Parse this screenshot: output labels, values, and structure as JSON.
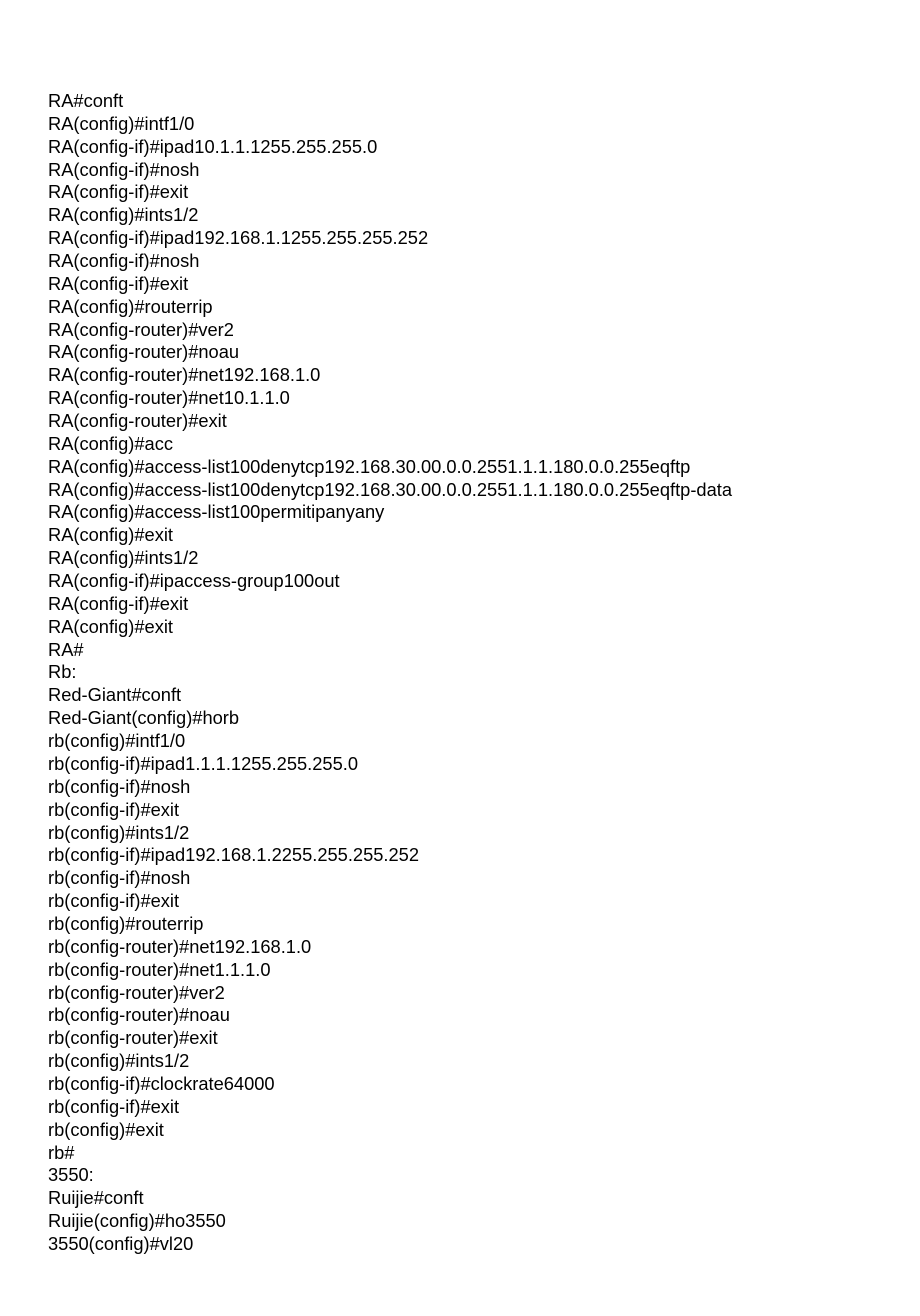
{
  "lines": [
    "RA#conft",
    "RA(config)#intf1/0",
    "RA(config-if)#ipad10.1.1.1255.255.255.0",
    "RA(config-if)#nosh",
    "RA(config-if)#exit",
    "RA(config)#ints1/2",
    "RA(config-if)#ipad192.168.1.1255.255.255.252",
    "RA(config-if)#nosh",
    "RA(config-if)#exit",
    "RA(config)#routerrip",
    "RA(config-router)#ver2",
    "RA(config-router)#noau",
    "RA(config-router)#net192.168.1.0",
    "RA(config-router)#net10.1.1.0",
    "RA(config-router)#exit",
    "RA(config)#acc",
    "RA(config)#access-list100denytcp192.168.30.00.0.0.2551.1.1.180.0.0.255eqftp",
    "RA(config)#access-list100denytcp192.168.30.00.0.0.2551.1.1.180.0.0.255eqftp-data",
    "RA(config)#access-list100permitipanyany",
    "RA(config)#exit",
    "RA(config)#ints1/2",
    "RA(config-if)#ipaccess-group100out",
    "RA(config-if)#exit",
    "RA(config)#exit",
    "RA#",
    "Rb:",
    "Red-Giant#conft",
    "Red-Giant(config)#horb",
    "rb(config)#intf1/0",
    "rb(config-if)#ipad1.1.1.1255.255.255.0",
    "rb(config-if)#nosh",
    "rb(config-if)#exit",
    "rb(config)#ints1/2",
    "rb(config-if)#ipad192.168.1.2255.255.255.252",
    "rb(config-if)#nosh",
    "rb(config-if)#exit",
    "rb(config)#routerrip",
    "rb(config-router)#net192.168.1.0",
    "rb(config-router)#net1.1.1.0",
    "rb(config-router)#ver2",
    "rb(config-router)#noau",
    "rb(config-router)#exit",
    "rb(config)#ints1/2",
    "rb(config-if)#clockrate64000",
    "rb(config-if)#exit",
    "rb(config)#exit",
    "rb#",
    "3550:",
    "Ruijie#conft",
    "Ruijie(config)#ho3550",
    "3550(config)#vl20"
  ]
}
